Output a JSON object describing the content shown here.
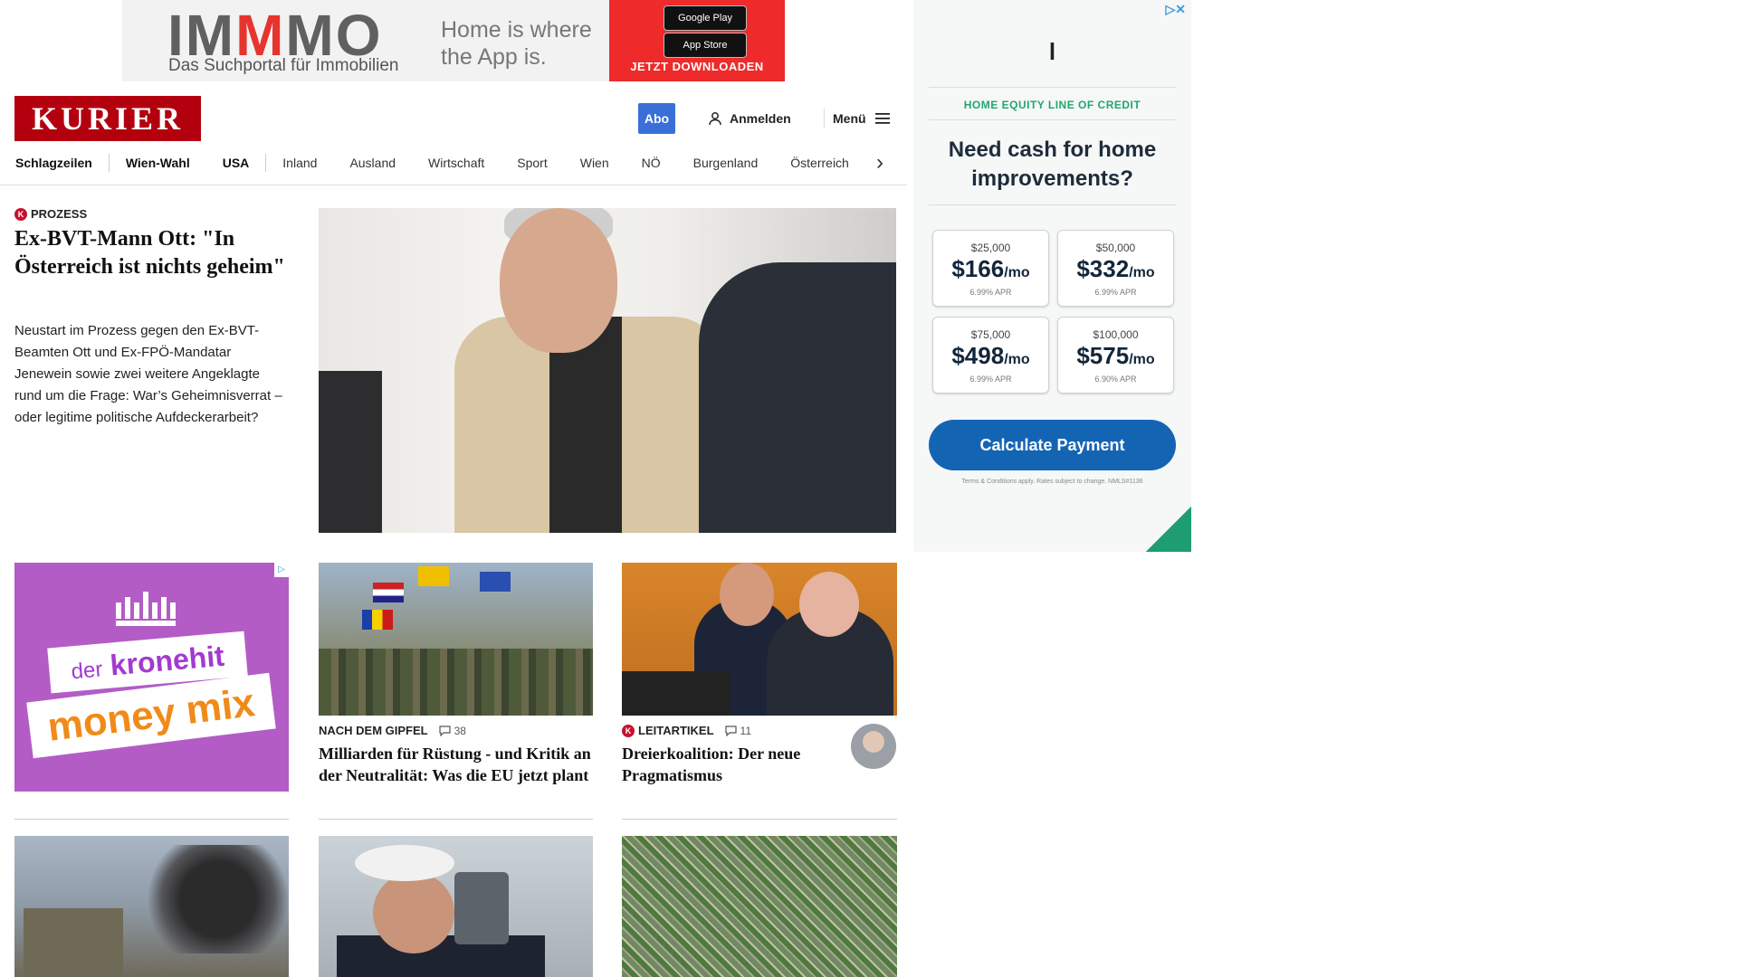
{
  "top_ad": {
    "brand_part1": "IM",
    "brand_part2": "M",
    "brand_part3": "MO",
    "brand_sub": "Das Suchportal für Immobilien",
    "tagline": "Home is where the App is.",
    "google_play": "Google Play",
    "app_store": "App Store",
    "cta": "JETZT DOWNLOADEN"
  },
  "header": {
    "logo": "KURIER",
    "abo": "Abo",
    "login": "Anmelden",
    "menu": "Menü"
  },
  "nav": {
    "items": [
      "Schlagzeilen",
      "Wien-Wahl",
      "USA",
      "Inland",
      "Ausland",
      "Wirtschaft",
      "Sport",
      "Wien",
      "NÖ",
      "Burgenland",
      "Österreich"
    ]
  },
  "lead": {
    "kicker": "PROZESS",
    "title": "Ex-BVT-Mann Ott: \"In Österreich ist nichts geheim\"",
    "teaser": "Neustart im Prozess gegen den Ex-BVT-Beamten Ott und Ex-FPÖ-Mandatar Jenewein sowie zwei weitere Angeklagte rund um die Frage: War’s Geheimnisverrat – oder legitime politische Aufdeckerarbeit?"
  },
  "kronehit_ad": {
    "line1_small": "der",
    "line1": "kronehit",
    "line2": "money mix"
  },
  "cards": [
    {
      "kicker": "NACH DEM GIPFEL",
      "comments": "38",
      "title": "Milliarden für Rüstung - und Kritik an der Neutralität: Was die EU jetzt plant"
    },
    {
      "kicker": "LEITARTIKEL",
      "comments": "11",
      "title": "Dreierkoalition: Der neue Pragmatismus"
    }
  ],
  "side_ad": {
    "logo": "l",
    "eyebrow": "HOME EQUITY LINE OF CREDIT",
    "headline": "Need cash for home improvements?",
    "tiles": [
      {
        "amount": "$25,000",
        "payment": "$166",
        "per": "/mo",
        "apr": "6.99% APR"
      },
      {
        "amount": "$50,000",
        "payment": "$332",
        "per": "/mo",
        "apr": "6.99% APR"
      },
      {
        "amount": "$75,000",
        "payment": "$498",
        "per": "/mo",
        "apr": "6.99% APR"
      },
      {
        "amount": "$100,000",
        "payment": "$575",
        "per": "/mo",
        "apr": "6.90% APR"
      }
    ],
    "cta": "Calculate Payment",
    "terms": "Terms & Conditions apply. Rates subject to change. NMLS#1136"
  },
  "colors": {
    "kurier_red": "#b3000f",
    "abo_blue": "#3a6fd8",
    "ad_green": "#22a66f",
    "cta_blue": "#1464b4"
  }
}
